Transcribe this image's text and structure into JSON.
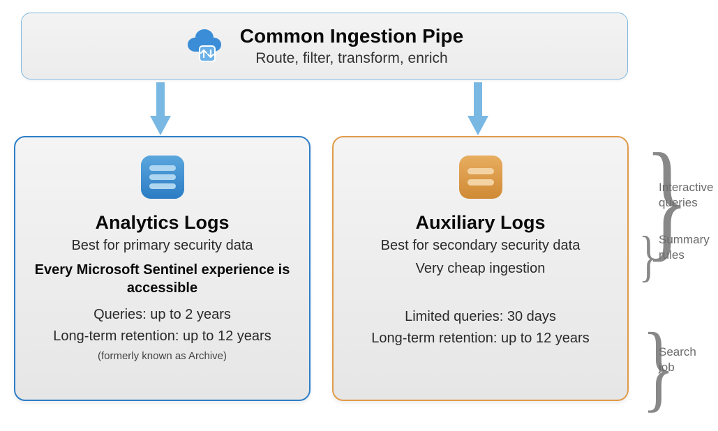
{
  "top": {
    "title": "Common Ingestion Pipe",
    "subtitle": "Route, filter, transform, enrich"
  },
  "analytics": {
    "title": "Analytics Logs",
    "subtitle": "Best for primary security data",
    "emphasis": "Every Microsoft Sentinel experience is accessible",
    "queries": "Queries: up to 2 years",
    "retention": "Long-term retention: up to 12 years",
    "retention_note": "(formerly known as Archive)"
  },
  "auxiliary": {
    "title": "Auxiliary Logs",
    "subtitle": "Best for secondary security data",
    "cheap": "Very cheap ingestion",
    "queries": "Limited queries: 30 days",
    "retention": "Long-term retention: up to 12 years"
  },
  "sideLabels": {
    "interactive": "Interactive queries",
    "summary": "Summary rules",
    "search": "Search job"
  },
  "icons": {
    "pipe": "pipe-cloud-icon",
    "analytics": "analytics-logs-icon",
    "auxiliary": "auxiliary-logs-icon"
  }
}
